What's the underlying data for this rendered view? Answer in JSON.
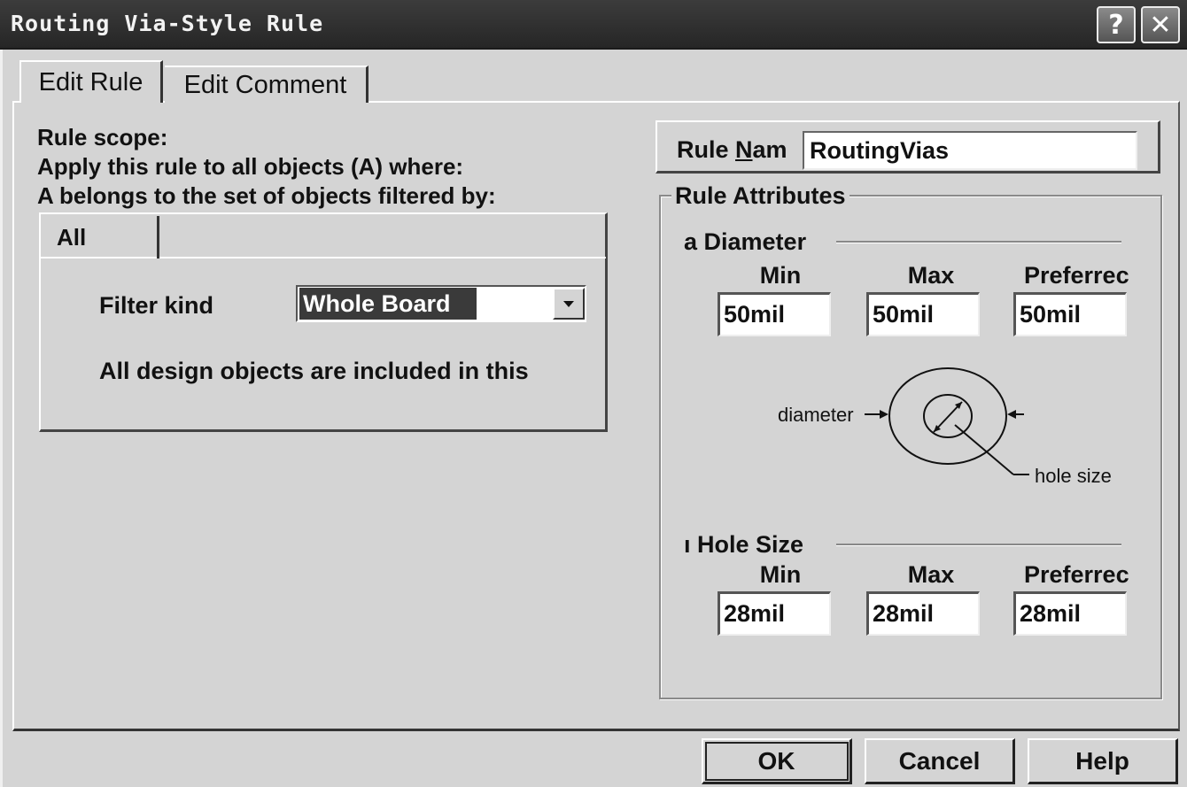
{
  "window": {
    "title": "Routing Via-Style Rule",
    "help_button": "?",
    "close_button": "✕"
  },
  "tabs": [
    {
      "label": "Edit Rule"
    },
    {
      "label": "Edit Comment"
    }
  ],
  "scope": {
    "line1": "Rule scope:",
    "line2": "Apply this rule to all objects (A) where:",
    "line3": "A belongs to the set of objects filtered by:",
    "filter_tab": "All",
    "filter_kind_label": "Filter kind",
    "filter_kind_value": "Whole Board",
    "description": "All design objects are included in this"
  },
  "rule_name": {
    "label_prefix": "Rule ",
    "label_mnemonic": "N",
    "label_suffix": "am",
    "value": "RoutingVias"
  },
  "attributes": {
    "title": "Rule Attributes",
    "diameter": {
      "title": "a Diameter",
      "headers": [
        "Min",
        "Max",
        "Preferrec"
      ],
      "values": [
        "50mil",
        "50mil",
        "50mil"
      ]
    },
    "hole_size": {
      "title": "ı Hole Size",
      "headers": [
        "Min",
        "Max",
        "Preferrec"
      ],
      "values": [
        "28mil",
        "28mil",
        "28mil"
      ]
    },
    "diagram": {
      "diameter_label": "diameter",
      "hole_label": "hole size"
    }
  },
  "buttons": {
    "ok": "OK",
    "cancel": "Cancel",
    "help": "Help"
  }
}
